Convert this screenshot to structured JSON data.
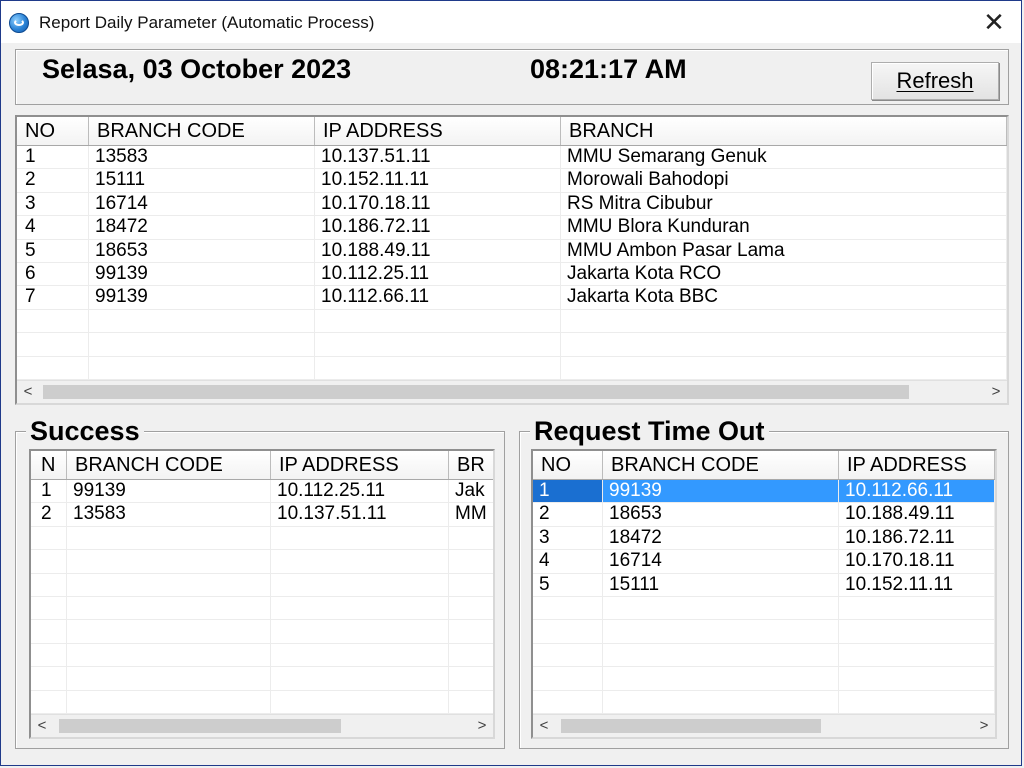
{
  "window": {
    "title": "Report Daily Parameter (Automatic Process)",
    "close_glyph": "✕"
  },
  "header": {
    "date": "Selasa, 03 October 2023",
    "time": "08:21:17 AM",
    "refresh_label": "Refresh"
  },
  "main_grid": {
    "columns": [
      "NO",
      "BRANCH CODE",
      "IP ADDRESS",
      "BRANCH"
    ],
    "rows": [
      [
        "1",
        "13583",
        "10.137.51.11",
        "MMU Semarang Genuk"
      ],
      [
        "2",
        "15111",
        "10.152.11.11",
        "Morowali Bahodopi"
      ],
      [
        "3",
        "16714",
        "10.170.18.11",
        "RS Mitra Cibubur"
      ],
      [
        "4",
        "18472",
        "10.186.72.11",
        "MMU Blora Kunduran"
      ],
      [
        "5",
        "18653",
        "10.188.49.11",
        "MMU Ambon Pasar Lama"
      ],
      [
        "6",
        "99139",
        "10.112.25.11",
        "Jakarta Kota RCO"
      ],
      [
        "7",
        "99139",
        "10.112.66.11",
        "Jakarta Kota BBC"
      ]
    ]
  },
  "success": {
    "title": "Success",
    "columns": [
      "N",
      "BRANCH CODE",
      "IP ADDRESS",
      "BR"
    ],
    "rows": [
      [
        "1",
        "99139",
        "10.112.25.11",
        "Jak"
      ],
      [
        "2",
        "13583",
        "10.137.51.11",
        "MM"
      ]
    ]
  },
  "timeout": {
    "title": "Request Time Out",
    "columns": [
      "NO",
      "BRANCH CODE",
      "IP ADDRESS"
    ],
    "selected_row": 0,
    "rows": [
      [
        "1",
        "99139",
        "10.112.66.11"
      ],
      [
        "2",
        "18653",
        "10.188.49.11"
      ],
      [
        "3",
        "18472",
        "10.186.72.11"
      ],
      [
        "4",
        "16714",
        "10.170.18.11"
      ],
      [
        "5",
        "15111",
        "10.152.11.11"
      ]
    ]
  },
  "scroll": {
    "left_arrow": "<",
    "right_arrow": ">"
  },
  "colors": {
    "selection": "#3399ff",
    "window_border": "#1f3a8a"
  }
}
